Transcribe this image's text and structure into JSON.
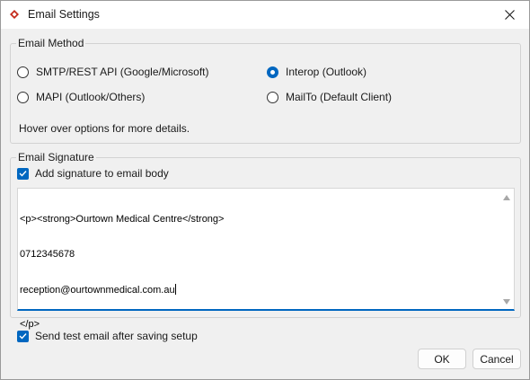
{
  "window": {
    "title": "Email Settings"
  },
  "email_method": {
    "group_label": "Email Method",
    "options": [
      {
        "label": "SMTP/REST API (Google/Microsoft)",
        "selected": false
      },
      {
        "label": "Interop (Outlook)",
        "selected": true
      },
      {
        "label": "MAPI (Outlook/Others)",
        "selected": false
      },
      {
        "label": "MailTo (Default Client)",
        "selected": false
      }
    ],
    "hint": "Hover over options for more details."
  },
  "email_signature": {
    "group_label": "Email Signature",
    "add_signature_label": "Add signature to email body",
    "add_signature_checked": true,
    "signature_lines": [
      "<p><strong>Ourtown Medical Centre</strong>",
      "0712345678",
      "reception@ourtownmedical.com.au",
      "</p>"
    ]
  },
  "send_test": {
    "label": "Send test email after saving setup",
    "checked": true
  },
  "buttons": {
    "ok": "OK",
    "cancel": "Cancel"
  },
  "colors": {
    "accent": "#0067c0",
    "app_icon": "#c42b1c"
  },
  "icons": {
    "app": "app-diamond-icon",
    "close": "close-icon"
  }
}
